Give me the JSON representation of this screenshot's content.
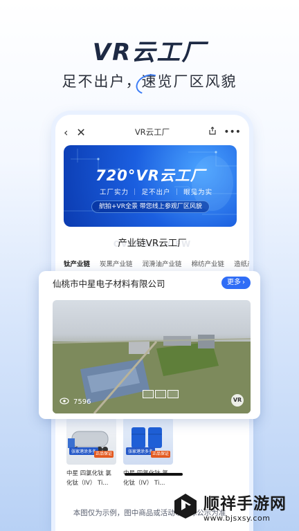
{
  "headline": "VR云工厂",
  "subline": "足不出户，速览厂区风貌",
  "app": {
    "nav": {
      "title": "VR云工厂"
    },
    "banner": {
      "title": "720°VR云工厂",
      "subtitle": "工厂实力 ｜ 足不出户 ｜ 眼见为实",
      "pill": "航拍+VR全景 带您线上参观厂区风貌"
    },
    "section": {
      "title": "产业链VR云工厂",
      "watermark": "OVERALL VIEW"
    },
    "chain_tabs": [
      "钛产业链",
      "炭黑产业链",
      "润滑油产业链",
      "棉纺产业链",
      "造纸产"
    ],
    "products": [
      {
        "name": "中星 四氯化钛 氯化钛（IV） Ti...",
        "shop_tag": "张家港涂多多",
        "badge": "正品保证",
        "image": "tanker"
      },
      {
        "name": "中星 四氯化钛 氯化钛（IV） Ti...",
        "shop_tag": "张家港涂多多",
        "badge": "正品保证",
        "image": "drums"
      }
    ]
  },
  "company_card": {
    "name": "仙桃市中星电子材料有限公司",
    "more_label": "更多",
    "view_count": "7596",
    "vr_label": "VR"
  },
  "disclaimer": "本图仅为示例，图中商品或活动以实际公示为准",
  "brand": {
    "name": "顺祥手游网",
    "url": "www.bjsxsy.com"
  },
  "colors": {
    "accent": "#2f6df6",
    "banner": "#1b5fe0",
    "headline": "#1e2a44"
  },
  "icons": [
    "back-icon",
    "close-icon",
    "share-icon",
    "more-dots-icon",
    "chevron-right-icon",
    "eye-icon",
    "vr-icon"
  ]
}
